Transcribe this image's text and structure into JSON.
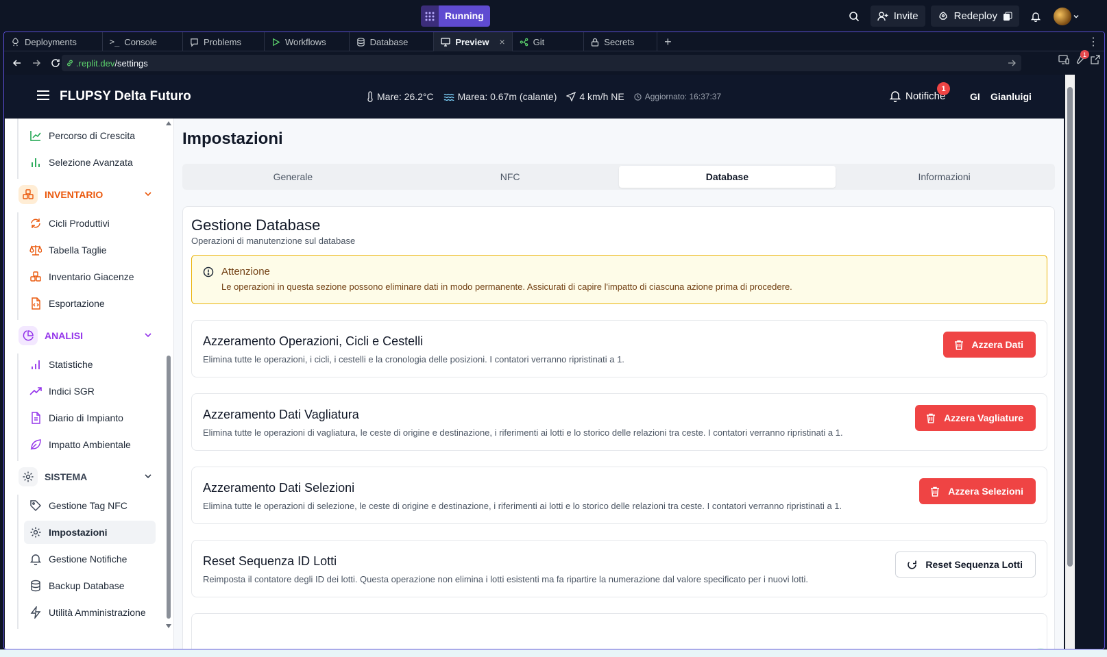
{
  "replit": {
    "run_label": "Running",
    "invite_label": "Invite",
    "redeploy_label": "Redeploy",
    "tabs": [
      {
        "label": "Deployments",
        "icon": "deploy-icon"
      },
      {
        "label": "Console",
        "icon": "console-icon"
      },
      {
        "label": "Problems",
        "icon": "problems-icon"
      },
      {
        "label": "Workflows",
        "icon": "play-icon"
      },
      {
        "label": "Database",
        "icon": "database-icon"
      },
      {
        "label": "Preview",
        "icon": "monitor-icon",
        "active": true,
        "close": "×"
      },
      {
        "label": "Git",
        "icon": "git-icon"
      },
      {
        "label": "Secrets",
        "icon": "lock-icon"
      }
    ],
    "new_tab": "+",
    "more": "⋮",
    "url_host": ".replit.dev",
    "url_path": "/settings",
    "devtools_badge": "1",
    "accent": "#5f4bd1"
  },
  "app": {
    "brand": "FLUPSY Delta Futuro",
    "weather": {
      "sea_temp": "Mare: 26.2°C",
      "tide": "Marea: 0.67m (calante)",
      "wind": "4 km/h NE",
      "updated": "Aggiornato: 16:37:37"
    },
    "notifications_label": "Notifiche",
    "notifications_count": "1",
    "user_initials": "GI",
    "user_name": "Gianluigi",
    "sidebar": {
      "top_items": [
        {
          "label": "Percorso di Crescita",
          "icon": "line-chart-icon"
        },
        {
          "label": "Selezione Avanzata",
          "icon": "bar-chart-icon"
        }
      ],
      "sections": [
        {
          "label": "INVENTARIO",
          "color": "#ea580c",
          "items": [
            {
              "label": "Cicli Produttivi",
              "icon": "refresh-icon"
            },
            {
              "label": "Tabella Taglie",
              "icon": "scale-icon"
            },
            {
              "label": "Inventario Giacenze",
              "icon": "boxes-icon"
            },
            {
              "label": "Esportazione",
              "icon": "file-code-icon"
            }
          ]
        },
        {
          "label": "ANALISI",
          "color": "#9333ea",
          "items": [
            {
              "label": "Statistiche",
              "icon": "bar-chart-icon"
            },
            {
              "label": "Indici SGR",
              "icon": "trending-up-icon"
            },
            {
              "label": "Diario di Impianto",
              "icon": "file-text-icon"
            },
            {
              "label": "Impatto Ambientale",
              "icon": "leaf-icon"
            }
          ]
        },
        {
          "label": "SISTEMA",
          "color": "#374151",
          "items": [
            {
              "label": "Gestione Tag NFC",
              "icon": "tag-icon"
            },
            {
              "label": "Impostazioni",
              "icon": "gear-icon",
              "active": true
            },
            {
              "label": "Gestione Notifiche",
              "icon": "bell-icon"
            },
            {
              "label": "Backup Database",
              "icon": "database-icon"
            },
            {
              "label": "Utilità Amministrazione",
              "icon": "zap-icon"
            }
          ]
        }
      ]
    },
    "page_title": "Impostazioni",
    "settings_tabs": [
      "Generale",
      "NFC",
      "Database",
      "Informazioni"
    ],
    "active_settings_tab": "Database",
    "card": {
      "title": "Gestione Database",
      "subtitle": "Operazioni di manutenzione sul database",
      "alert_title": "Attenzione",
      "alert_text": "Le operazioni in questa sezione possono eliminare dati in modo permanente. Assicurati di capire l'impatto di ciascuna azione prima di procedere.",
      "operations": [
        {
          "title": "Azzeramento Operazioni, Cicli e Cestelli",
          "description": "Elimina tutte le operazioni, i cicli, i cestelli e la cronologia delle posizioni. I contatori verranno ripristinati a 1.",
          "button": "Azzera Dati",
          "style": "danger"
        },
        {
          "title": "Azzeramento Dati Vagliatura",
          "description": "Elimina tutte le operazioni di vagliatura, le ceste di origine e destinazione, i riferimenti ai lotti e lo storico delle relazioni tra ceste. I contatori verranno ripristinati a 1.",
          "button": "Azzera Vagliature",
          "style": "danger"
        },
        {
          "title": "Azzeramento Dati Selezioni",
          "description": "Elimina tutte le operazioni di selezione, le ceste di origine e destinazione, i riferimenti ai lotti e lo storico delle relazioni tra ceste. I contatori verranno ripristinati a 1.",
          "button": "Azzera Selezioni",
          "style": "danger"
        },
        {
          "title": "Reset Sequenza ID Lotti",
          "description": "Reimposta il contatore degli ID dei lotti. Questa operazione non elimina i lotti esistenti ma fa ripartire la numerazione dal valore specificato per i nuovi lotti.",
          "button": "Reset Sequenza Lotti",
          "style": "outline"
        }
      ]
    },
    "danger_color": "#ef4444"
  }
}
